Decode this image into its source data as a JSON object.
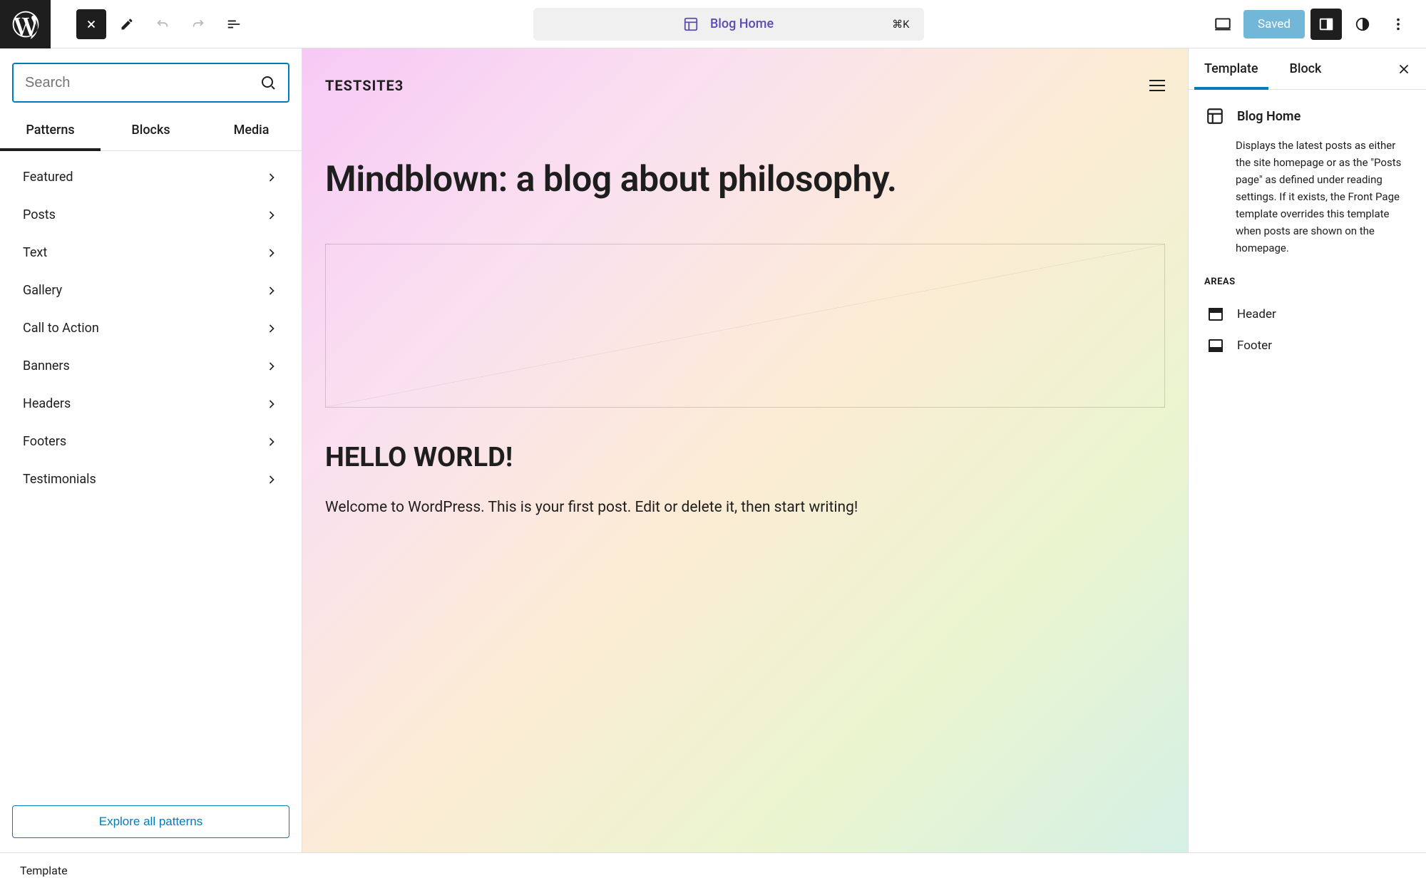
{
  "topbar": {
    "doc_title": "Blog Home",
    "kbd": "⌘K",
    "saved_label": "Saved"
  },
  "search": {
    "placeholder": "Search"
  },
  "inserter_tabs": {
    "patterns": "Patterns",
    "blocks": "Blocks",
    "media": "Media"
  },
  "categories": [
    "Featured",
    "Posts",
    "Text",
    "Gallery",
    "Call to Action",
    "Banners",
    "Headers",
    "Footers",
    "Testimonials"
  ],
  "explore_label": "Explore all patterns",
  "canvas": {
    "site_title": "TESTSITE3",
    "hero": "Mindblown: a blog about philosophy.",
    "post_title": "HELLO WORLD!",
    "post_excerpt": "Welcome to WordPress. This is your first post. Edit or delete it, then start writing!"
  },
  "sidebar": {
    "tab_template": "Template",
    "tab_block": "Block",
    "template_name": "Blog Home",
    "template_desc": "Displays the latest posts as either the site homepage or as the \"Posts page\" as defined under reading settings. If it exists, the Front Page template overrides this template when posts are shown on the homepage.",
    "areas_label": "AREAS",
    "areas": [
      "Header",
      "Footer"
    ]
  },
  "footer": {
    "breadcrumb": "Template"
  }
}
